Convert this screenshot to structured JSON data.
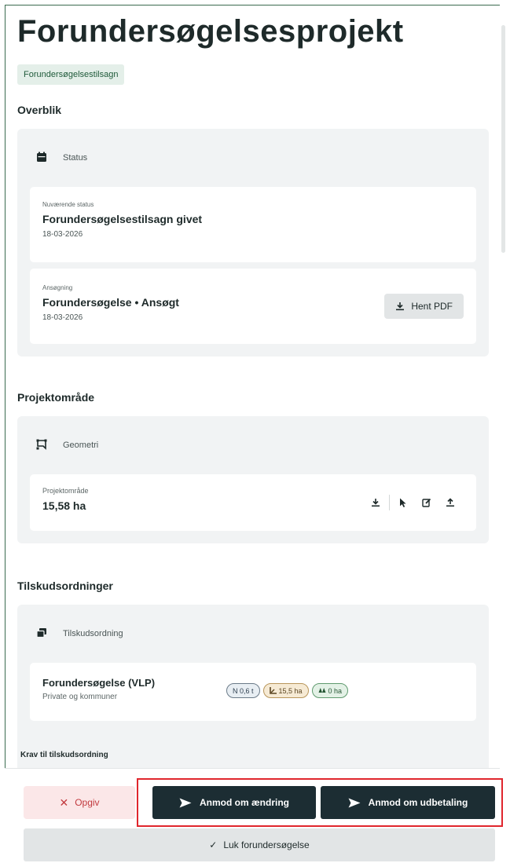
{
  "page": {
    "title": "Forundersøgelsesprojekt",
    "tag": "Forundersøgelsestilsagn"
  },
  "overblik": {
    "heading": "Overblik",
    "panel_title": "Status",
    "icon": "calendar-icon",
    "current": {
      "label": "Nuværende status",
      "value": "Forundersøgelsestilsagn givet",
      "date": "18-03-2026"
    },
    "application": {
      "label": "Ansøgning",
      "value": "Forundersøgelse • Ansøgt",
      "date": "18-03-2026",
      "pdf_button": "Hent PDF"
    }
  },
  "projektomraade": {
    "heading": "Projektområde",
    "panel_title": "Geometri",
    "icon": "polygon-icon",
    "card": {
      "label": "Projektområde",
      "value": "15,58 ha"
    },
    "actions": [
      "download-icon",
      "cursor-icon",
      "edit-icon",
      "upload-icon"
    ]
  },
  "tilskud": {
    "heading": "Tilskudsordninger",
    "panel_title": "Tilskudsordning",
    "icon": "layers-icon",
    "card": {
      "name": "Forundersøgelse (VLP)",
      "sub": "Private og kommuner",
      "pills": {
        "n": "N 0,6 t",
        "ha": "15,5 ha",
        "zero": "0 ha"
      }
    },
    "krav": "Krav til tilskudsordning"
  },
  "footer": {
    "opgiv": "Opgiv",
    "aendring": "Anmod om ændring",
    "udbetaling": "Anmod om udbetaling",
    "luk": "Luk forundersøgelse"
  },
  "colors": {
    "primary_dark": "#1c2d33",
    "danger": "#c23a3f",
    "highlight": "#e0262d"
  }
}
